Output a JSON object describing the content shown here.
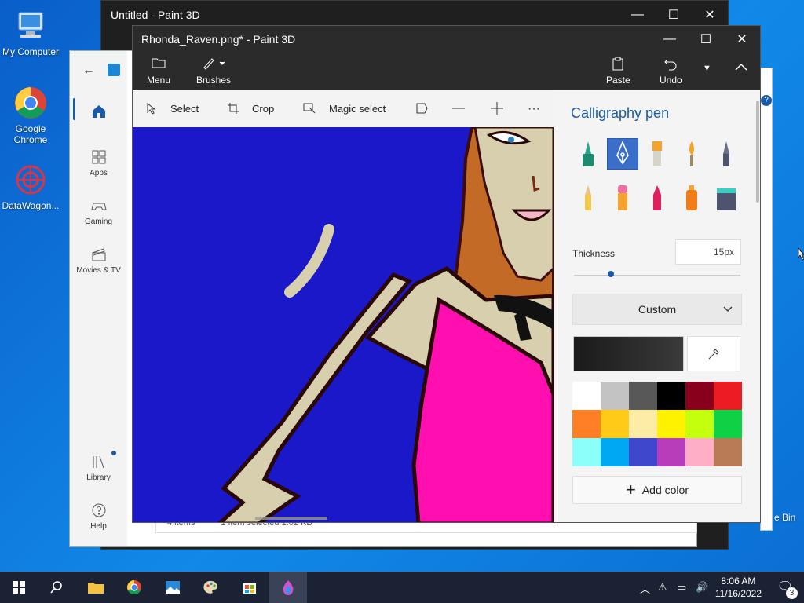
{
  "desktop": {
    "icons": [
      {
        "label": "My Computer"
      },
      {
        "label": "Google Chrome"
      },
      {
        "label": "DataWagon..."
      }
    ],
    "recycle_bin_label": "e Bin"
  },
  "background_window": {
    "title": "Untitled - Paint 3D"
  },
  "store": {
    "nav": [
      {
        "label": "Apps"
      },
      {
        "label": "Gaming"
      },
      {
        "label": "Movies & TV"
      },
      {
        "label": "Library"
      },
      {
        "label": "Help"
      }
    ]
  },
  "explorer_status": {
    "items": "4 items",
    "selected": "1 item selected  1.02 KB"
  },
  "paint3d": {
    "title": "Rhonda_Raven.png* - Paint 3D",
    "ribbon": {
      "menu": "Menu",
      "brushes": "Brushes",
      "paste": "Paste",
      "undo": "Undo"
    },
    "tools": {
      "select": "Select",
      "crop": "Crop",
      "magic_select": "Magic select"
    },
    "panel": {
      "title": "Calligraphy pen",
      "thickness_label": "Thickness",
      "thickness_value": "15px",
      "thickness_level": 0.22,
      "dropdown_value": "Custom",
      "add_color": "Add color",
      "swatches": [
        "#ffffff",
        "#c3c3c3",
        "#585858",
        "#000000",
        "#88001b",
        "#ec1c24",
        "#ff7f27",
        "#ffca18",
        "#fdeca6",
        "#fff200",
        "#c4ff0e",
        "#0ed145",
        "#8cfffb",
        "#00a8f3",
        "#3f48cc",
        "#b83dba",
        "#ffaec8",
        "#b97a56"
      ]
    }
  },
  "taskbar": {
    "time": "8:06 AM",
    "date": "11/16/2022",
    "notifications": "3"
  }
}
